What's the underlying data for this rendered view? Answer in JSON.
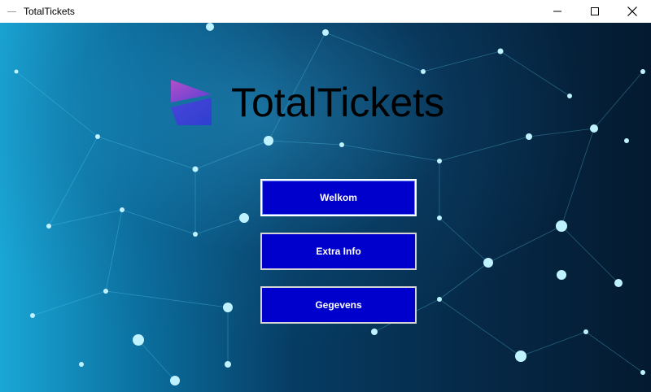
{
  "window": {
    "title": "TotalTickets"
  },
  "titlebar": {
    "icons": {
      "minimize": "minimize-icon",
      "maximize": "maximize-icon",
      "close": "close-icon"
    }
  },
  "logo": {
    "text": "TotalTickets",
    "colors": [
      "#b24fc8",
      "#5a3fd6",
      "#2f3fd0"
    ]
  },
  "menu": {
    "welkom_label": "Welkom",
    "extra_info_label": "Extra Info",
    "gegevens_label": "Gegevens"
  },
  "theme": {
    "button_bg": "#0000cc",
    "button_text": "#ffffff",
    "button_border": "#d4d4d4"
  }
}
